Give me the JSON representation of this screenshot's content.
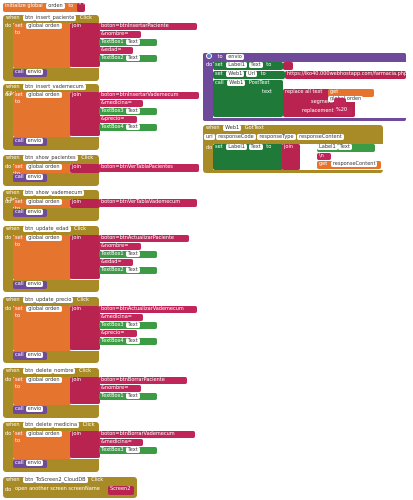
{
  "init": {
    "label": "initialize global",
    "name": "orden",
    "to": "to",
    "value": "\" \""
  },
  "events": [
    {
      "component": "btn_insert_paciente",
      "event": "Click",
      "do": "do",
      "set": "set",
      "var": "global orden",
      "to": "to",
      "join": "join",
      "strings": [
        "boton=btnInsertarPaciente",
        "&nombre=",
        "&edad=",
        "&sexo="
      ],
      "textboxes": [
        "TextBox1",
        "TextBox2"
      ],
      "text": "Text",
      "call": "call",
      "proc": "envio"
    },
    {
      "component": "btn_insert_vademecum",
      "event": "Click",
      "do": "do",
      "set": "set",
      "var": "global orden",
      "to": "to",
      "join": "join",
      "strings": [
        "boton=btnInsertarVademecum",
        "&medicina=",
        "&precio="
      ],
      "textboxes": [
        "TextBox3",
        "TextBox4"
      ],
      "text": "Text",
      "call": "call",
      "proc": "envio"
    },
    {
      "component": "btn_show_pacientes",
      "event": "Click",
      "do": "do",
      "set": "set",
      "var": "global orden",
      "to": "to",
      "join": "join",
      "strings": [
        "boton=btnVerTablaPacientes"
      ],
      "call": "call",
      "proc": "envio"
    },
    {
      "component": "btn_show_vademecum",
      "event": "Click",
      "do": "do",
      "set": "set",
      "var": "global orden",
      "to": "to",
      "join": "join",
      "strings": [
        "boton=btnVerTablaVademecum"
      ],
      "call": "call",
      "proc": "envio"
    },
    {
      "component": "btn_update_edad",
      "event": "Click",
      "do": "do",
      "set": "set",
      "var": "global orden",
      "to": "to",
      "join": "join",
      "strings": [
        "boton=btnActualizarPaciente",
        "&nombre=",
        "&edad="
      ],
      "textboxes": [
        "TextBox1",
        "TextBox2"
      ],
      "text": "Text",
      "call": "call",
      "proc": "envio"
    },
    {
      "component": "btn_update_precio",
      "event": "Click",
      "do": "do",
      "set": "set",
      "var": "global orden",
      "to": "to",
      "join": "join",
      "strings": [
        "boton=btnActualizarVademecum",
        "&medicina=",
        "&precio="
      ],
      "textboxes": [
        "TextBox3",
        "TextBox4"
      ],
      "text": "Text",
      "call": "call",
      "proc": "envio"
    },
    {
      "component": "btn_delete_nombre",
      "event": "Click",
      "do": "do",
      "set": "set",
      "var": "global orden",
      "to": "to",
      "join": "join",
      "strings": [
        "boton=btnBorrarPaciente",
        "&nombre="
      ],
      "textboxes": [
        "TextBox1"
      ],
      "text": "Text",
      "call": "call",
      "proc": "envio"
    },
    {
      "component": "btn_delete_medicina",
      "event": "Click",
      "do": "do",
      "set": "set",
      "var": "global orden",
      "to": "to",
      "join": "join",
      "strings": [
        "boton=btnBorrarVademecum",
        "&medicina="
      ],
      "textboxes": [
        "TextBox3"
      ],
      "text": "Text",
      "call": "call",
      "proc": "envio"
    },
    {
      "component": "btn_ToScreen2_CloudDB",
      "event": "Click",
      "do": "do",
      "action": "open another screen  screenName",
      "screen": "Screen2"
    }
  ],
  "envio": {
    "to": "to",
    "name": "envio",
    "do": "do",
    "set": "set",
    "label": "Label1",
    "text": "Text",
    "toword": "to",
    "set2": "set",
    "web": "Web1",
    "url": "Url",
    "urlvalue": "https://lko40.000webhostapp.com/farmacia.php",
    "call": "call",
    "post": "PostText",
    "textlabel": "text",
    "replace": "replace all text",
    "get": "get",
    "gvar": "global orden",
    "segment": "segment",
    "segval": " ",
    "replacement": "replacement",
    "repval": "%20"
  },
  "gottext": {
    "when": "when",
    "comp": "Web1",
    "event": "GotText",
    "url": "url",
    "responseCode": "responseCode",
    "responseType": "responseType",
    "responseContent": "responseContent",
    "do": "do",
    "set": "set",
    "label": "Label1",
    "text": "Text",
    "to": "to",
    "join": "join",
    "get": "get",
    "content": "responseContent"
  },
  "colors": {
    "event": "#a88b26",
    "variable": "#e5742e",
    "procedure": "#6f4a9a",
    "text": "#b8244f",
    "component": "#3c9b45",
    "background": "#ffffff"
  }
}
